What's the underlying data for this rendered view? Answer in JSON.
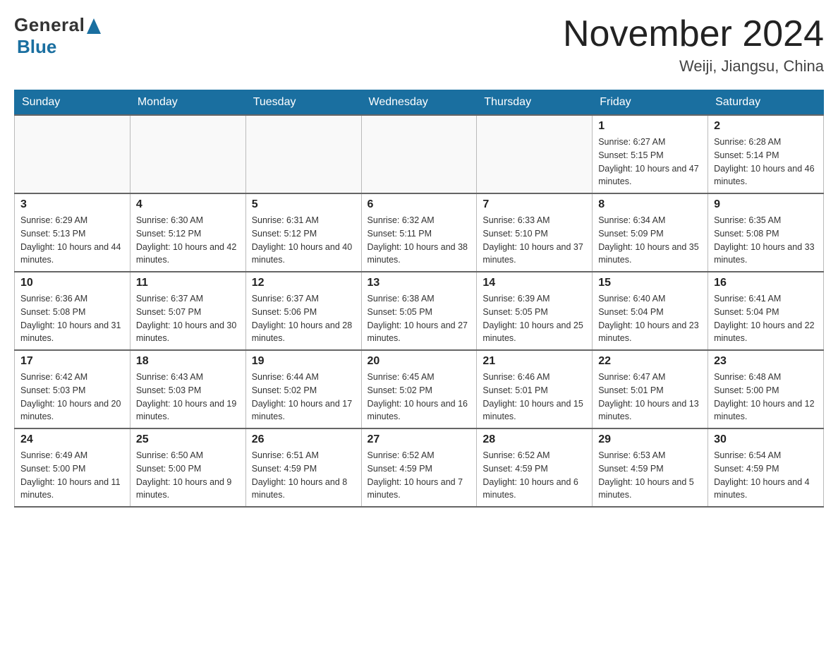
{
  "header": {
    "logo_general": "General",
    "logo_triangle": "▶",
    "logo_blue": "Blue",
    "month_title": "November 2024",
    "location": "Weiji, Jiangsu, China"
  },
  "days_of_week": [
    "Sunday",
    "Monday",
    "Tuesday",
    "Wednesday",
    "Thursday",
    "Friday",
    "Saturday"
  ],
  "weeks": [
    [
      {
        "day": "",
        "info": ""
      },
      {
        "day": "",
        "info": ""
      },
      {
        "day": "",
        "info": ""
      },
      {
        "day": "",
        "info": ""
      },
      {
        "day": "",
        "info": ""
      },
      {
        "day": "1",
        "info": "Sunrise: 6:27 AM\nSunset: 5:15 PM\nDaylight: 10 hours and 47 minutes."
      },
      {
        "day": "2",
        "info": "Sunrise: 6:28 AM\nSunset: 5:14 PM\nDaylight: 10 hours and 46 minutes."
      }
    ],
    [
      {
        "day": "3",
        "info": "Sunrise: 6:29 AM\nSunset: 5:13 PM\nDaylight: 10 hours and 44 minutes."
      },
      {
        "day": "4",
        "info": "Sunrise: 6:30 AM\nSunset: 5:12 PM\nDaylight: 10 hours and 42 minutes."
      },
      {
        "day": "5",
        "info": "Sunrise: 6:31 AM\nSunset: 5:12 PM\nDaylight: 10 hours and 40 minutes."
      },
      {
        "day": "6",
        "info": "Sunrise: 6:32 AM\nSunset: 5:11 PM\nDaylight: 10 hours and 38 minutes."
      },
      {
        "day": "7",
        "info": "Sunrise: 6:33 AM\nSunset: 5:10 PM\nDaylight: 10 hours and 37 minutes."
      },
      {
        "day": "8",
        "info": "Sunrise: 6:34 AM\nSunset: 5:09 PM\nDaylight: 10 hours and 35 minutes."
      },
      {
        "day": "9",
        "info": "Sunrise: 6:35 AM\nSunset: 5:08 PM\nDaylight: 10 hours and 33 minutes."
      }
    ],
    [
      {
        "day": "10",
        "info": "Sunrise: 6:36 AM\nSunset: 5:08 PM\nDaylight: 10 hours and 31 minutes."
      },
      {
        "day": "11",
        "info": "Sunrise: 6:37 AM\nSunset: 5:07 PM\nDaylight: 10 hours and 30 minutes."
      },
      {
        "day": "12",
        "info": "Sunrise: 6:37 AM\nSunset: 5:06 PM\nDaylight: 10 hours and 28 minutes."
      },
      {
        "day": "13",
        "info": "Sunrise: 6:38 AM\nSunset: 5:05 PM\nDaylight: 10 hours and 27 minutes."
      },
      {
        "day": "14",
        "info": "Sunrise: 6:39 AM\nSunset: 5:05 PM\nDaylight: 10 hours and 25 minutes."
      },
      {
        "day": "15",
        "info": "Sunrise: 6:40 AM\nSunset: 5:04 PM\nDaylight: 10 hours and 23 minutes."
      },
      {
        "day": "16",
        "info": "Sunrise: 6:41 AM\nSunset: 5:04 PM\nDaylight: 10 hours and 22 minutes."
      }
    ],
    [
      {
        "day": "17",
        "info": "Sunrise: 6:42 AM\nSunset: 5:03 PM\nDaylight: 10 hours and 20 minutes."
      },
      {
        "day": "18",
        "info": "Sunrise: 6:43 AM\nSunset: 5:03 PM\nDaylight: 10 hours and 19 minutes."
      },
      {
        "day": "19",
        "info": "Sunrise: 6:44 AM\nSunset: 5:02 PM\nDaylight: 10 hours and 17 minutes."
      },
      {
        "day": "20",
        "info": "Sunrise: 6:45 AM\nSunset: 5:02 PM\nDaylight: 10 hours and 16 minutes."
      },
      {
        "day": "21",
        "info": "Sunrise: 6:46 AM\nSunset: 5:01 PM\nDaylight: 10 hours and 15 minutes."
      },
      {
        "day": "22",
        "info": "Sunrise: 6:47 AM\nSunset: 5:01 PM\nDaylight: 10 hours and 13 minutes."
      },
      {
        "day": "23",
        "info": "Sunrise: 6:48 AM\nSunset: 5:00 PM\nDaylight: 10 hours and 12 minutes."
      }
    ],
    [
      {
        "day": "24",
        "info": "Sunrise: 6:49 AM\nSunset: 5:00 PM\nDaylight: 10 hours and 11 minutes."
      },
      {
        "day": "25",
        "info": "Sunrise: 6:50 AM\nSunset: 5:00 PM\nDaylight: 10 hours and 9 minutes."
      },
      {
        "day": "26",
        "info": "Sunrise: 6:51 AM\nSunset: 4:59 PM\nDaylight: 10 hours and 8 minutes."
      },
      {
        "day": "27",
        "info": "Sunrise: 6:52 AM\nSunset: 4:59 PM\nDaylight: 10 hours and 7 minutes."
      },
      {
        "day": "28",
        "info": "Sunrise: 6:52 AM\nSunset: 4:59 PM\nDaylight: 10 hours and 6 minutes."
      },
      {
        "day": "29",
        "info": "Sunrise: 6:53 AM\nSunset: 4:59 PM\nDaylight: 10 hours and 5 minutes."
      },
      {
        "day": "30",
        "info": "Sunrise: 6:54 AM\nSunset: 4:59 PM\nDaylight: 10 hours and 4 minutes."
      }
    ]
  ]
}
